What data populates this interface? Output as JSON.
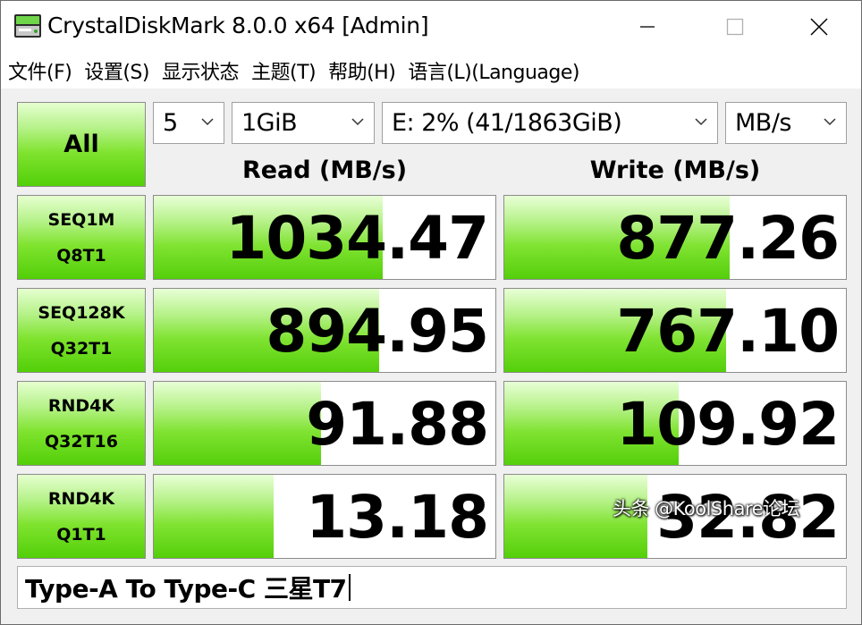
{
  "window": {
    "title": "CrystalDiskMark 8.0.0 x64 [Admin]",
    "icons": {
      "app": "crystaldiskmark-icon",
      "minimize": "minimize-icon",
      "maximize": "maximize-icon",
      "close": "close-icon"
    }
  },
  "menu": {
    "items": [
      {
        "label": "文件(F)"
      },
      {
        "label": "设置(S)"
      },
      {
        "label": "显示状态"
      },
      {
        "label": "主题(T)"
      },
      {
        "label": "帮助(H)"
      },
      {
        "label": "语言(L)(Language)"
      }
    ]
  },
  "controls": {
    "all_label": "All",
    "count": "5",
    "size": "1GiB",
    "drive": "E: 2% (41/1863GiB)",
    "unit": "MB/s"
  },
  "headers": {
    "read": "Read (MB/s)",
    "write": "Write (MB/s)"
  },
  "tests": [
    {
      "line1": "SEQ1M",
      "line2": "Q8T1",
      "read": "1034.47",
      "write": "877.26",
      "read_fill": 0.67,
      "write_fill": 0.66
    },
    {
      "line1": "SEQ128K",
      "line2": "Q32T1",
      "read": "894.95",
      "write": "767.10",
      "read_fill": 0.66,
      "write_fill": 0.65
    },
    {
      "line1": "RND4K",
      "line2": "Q32T16",
      "read": "91.88",
      "write": "109.92",
      "read_fill": 0.49,
      "write_fill": 0.51
    },
    {
      "line1": "RND4K",
      "line2": "Q1T1",
      "read": "13.18",
      "write": "32.82",
      "read_fill": 0.35,
      "write_fill": 0.42
    }
  ],
  "comment": "Type-A To Type-C 三星T7",
  "watermark": "头条 @KoolShare论坛",
  "colors": {
    "bar_green": "#54cf0a",
    "bar_light": "#e8ffd6"
  }
}
